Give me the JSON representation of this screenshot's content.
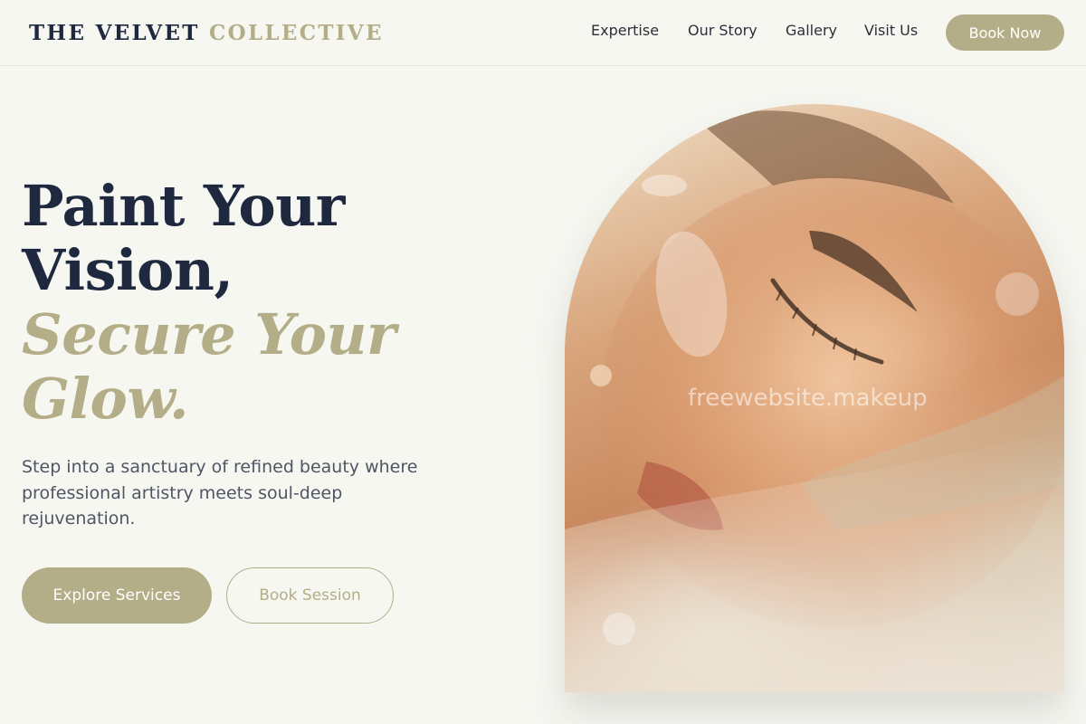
{
  "brand": {
    "name_primary": "THE VELVET",
    "name_accent": "COLLECTIVE"
  },
  "nav": {
    "items": [
      "Expertise",
      "Our Story",
      "Gallery",
      "Visit Us"
    ],
    "cta_label": "Book Now"
  },
  "hero": {
    "headline_line1": "Paint Your",
    "headline_line2": "Vision,",
    "headline_accent_line1": "Secure Your",
    "headline_accent_line2": "Glow.",
    "subtitle": "Step into a sanctuary of refined beauty where professional artistry meets soul-deep rejuvenation.",
    "primary_button": "Explore Services",
    "secondary_button": "Book Session",
    "image_watermark": "freewebsite.makeup"
  },
  "colors": {
    "background": "#f7f7f2",
    "navy": "#1e2940",
    "accent_gold": "#b3ad88",
    "body_text": "#4f5563"
  }
}
